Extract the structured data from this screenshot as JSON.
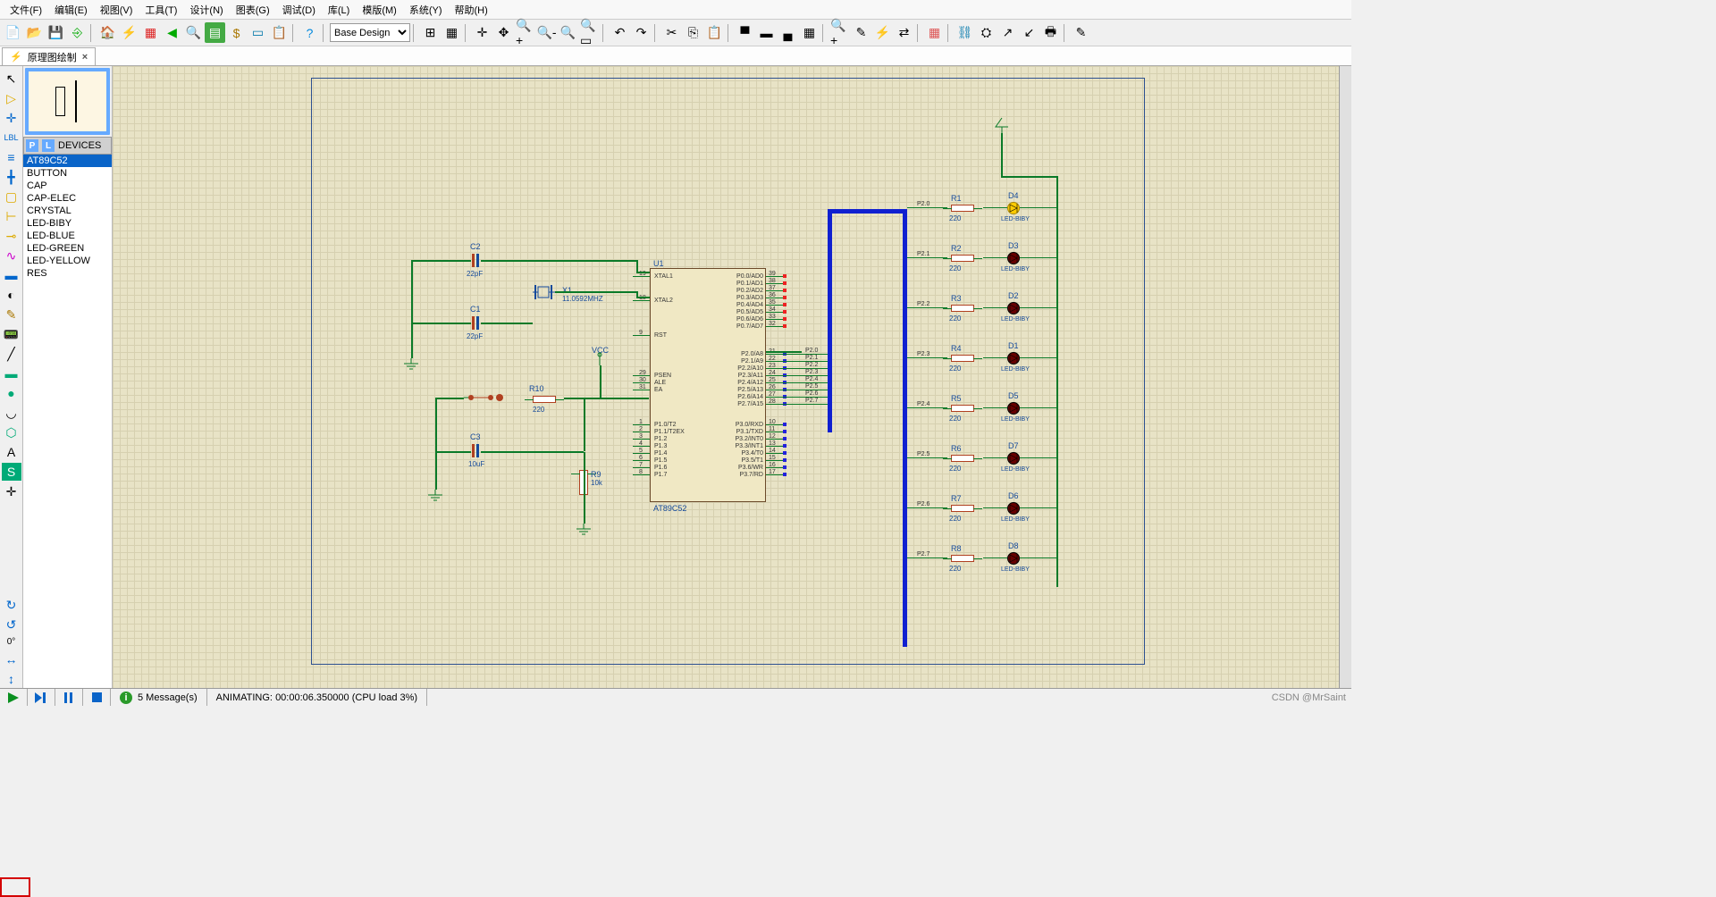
{
  "menu": [
    "文件(F)",
    "编辑(E)",
    "视图(V)",
    "工具(T)",
    "设计(N)",
    "图表(G)",
    "调试(D)",
    "库(L)",
    "模版(M)",
    "系统(Y)",
    "帮助(H)"
  ],
  "combo": {
    "value": "Base Design"
  },
  "tab": {
    "label": "原理图绘制"
  },
  "devices_header": "DEVICES",
  "devices": [
    "AT89C52",
    "BUTTON",
    "CAP",
    "CAP-ELEC",
    "CRYSTAL",
    "LED-BIBY",
    "LED-BLUE",
    "LED-GREEN",
    "LED-YELLOW",
    "RES"
  ],
  "rotation": "0°",
  "status": {
    "messages": "5 Message(s)",
    "animating_label": "ANIMATING:",
    "time": "00:00:06.350000",
    "cpu": "(CPU load 3%)"
  },
  "chip": {
    "ref": "U1",
    "part": "AT89C52",
    "left_pins": [
      "XTAL1",
      "XTAL2",
      "RST",
      "PSEN",
      "ALE",
      "EA",
      "P1.0/T2",
      "P1.1/T2EX",
      "P1.2",
      "P1.3",
      "P1.4",
      "P1.5",
      "P1.6",
      "P1.7"
    ],
    "left_nums": [
      "19",
      "18",
      "9",
      "29",
      "30",
      "31",
      "1",
      "2",
      "3",
      "4",
      "5",
      "6",
      "7",
      "8"
    ],
    "right_pins": [
      "P0.0/AD0",
      "P0.1/AD1",
      "P0.2/AD2",
      "P0.3/AD3",
      "P0.4/AD4",
      "P0.5/AD5",
      "P0.6/AD6",
      "P0.7/AD7",
      "P2.0/A8",
      "P2.1/A9",
      "P2.2/A10",
      "P2.3/A11",
      "P2.4/A12",
      "P2.5/A13",
      "P2.6/A14",
      "P2.7/A15",
      "P3.0/RXD",
      "P3.1/TXD",
      "P3.2/INT0",
      "P3.3/INT1",
      "P3.4/T0",
      "P3.5/T1",
      "P3.6/WR",
      "P3.7/RD"
    ],
    "right_nums": [
      "39",
      "38",
      "37",
      "36",
      "35",
      "34",
      "33",
      "32",
      "21",
      "22",
      "23",
      "24",
      "25",
      "26",
      "27",
      "28",
      "10",
      "11",
      "12",
      "13",
      "14",
      "15",
      "16",
      "17"
    ]
  },
  "crystal": {
    "ref": "X1",
    "value": "11.0592MHZ"
  },
  "caps": [
    {
      "ref": "C2",
      "value": "22pF"
    },
    {
      "ref": "C1",
      "value": "22pF"
    },
    {
      "ref": "C3",
      "value": "10uF"
    }
  ],
  "r9": {
    "ref": "R9",
    "value": "10k"
  },
  "r10": {
    "ref": "R10",
    "value": "220"
  },
  "vcc": "VCC",
  "led_block": {
    "rows": [
      {
        "net": "P2.0",
        "r": "R1",
        "rv": "220",
        "led": "D4",
        "lv": "LED-BIBY",
        "on": true
      },
      {
        "net": "P2.1",
        "r": "R2",
        "rv": "220",
        "led": "D3",
        "lv": "LED-BIBY",
        "on": false
      },
      {
        "net": "P2.2",
        "r": "R3",
        "rv": "220",
        "led": "D2",
        "lv": "LED-BIBY",
        "on": false
      },
      {
        "net": "P2.3",
        "r": "R4",
        "rv": "220",
        "led": "D1",
        "lv": "LED-BIBY",
        "on": false
      },
      {
        "net": "P2.4",
        "r": "R5",
        "rv": "220",
        "led": "D5",
        "lv": "LED-BIBY",
        "on": false
      },
      {
        "net": "P2.5",
        "r": "R6",
        "rv": "220",
        "led": "D7",
        "lv": "LED-BIBY",
        "on": false
      },
      {
        "net": "P2.6",
        "r": "R7",
        "rv": "220",
        "led": "D6",
        "lv": "LED-BIBY",
        "on": false
      },
      {
        "net": "P2.7",
        "r": "R8",
        "rv": "220",
        "led": "D8",
        "lv": "LED-BIBY",
        "on": false
      }
    ],
    "bus_labels": [
      "P2.0",
      "P2.1",
      "P2.2",
      "P2.3",
      "P2.4",
      "P2.5",
      "P2.6",
      "P2.7"
    ]
  },
  "watermark": "CSDN @MrSaint"
}
